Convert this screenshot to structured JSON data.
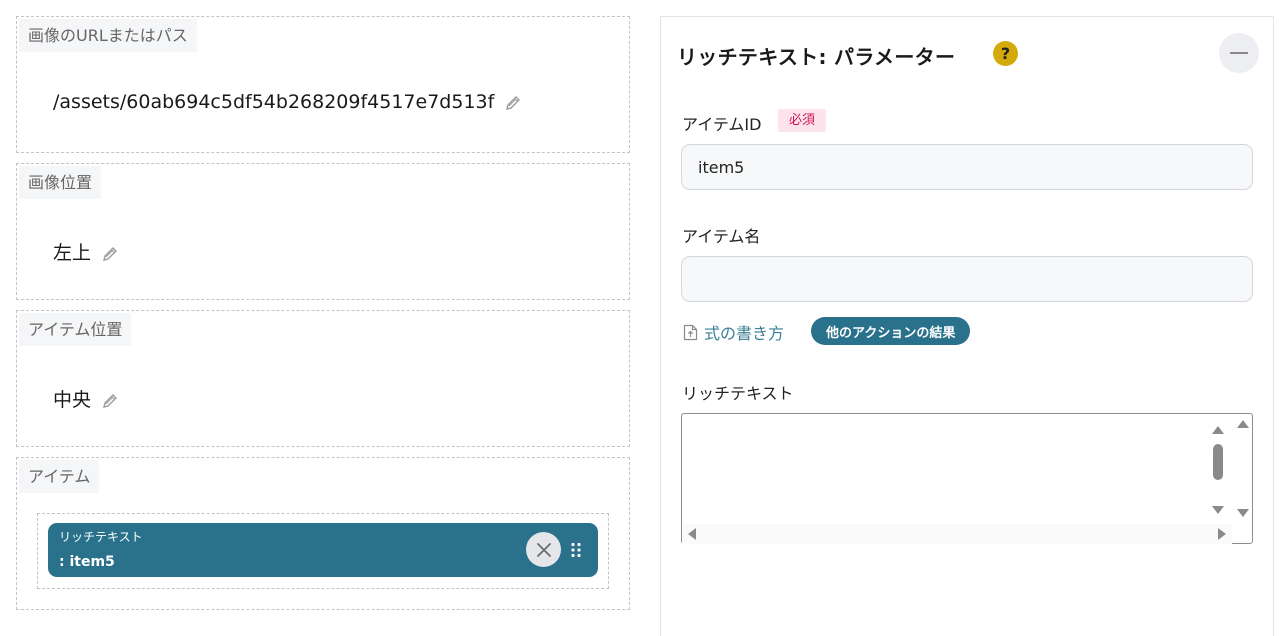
{
  "left": {
    "image_url": {
      "label": "画像のURLまたはパス",
      "value": "/assets/60ab694c5df54b268209f4517e7d513f"
    },
    "image_position": {
      "label": "画像位置",
      "value": "左上"
    },
    "item_position": {
      "label": "アイテム位置",
      "value": "中央"
    },
    "items": {
      "label": "アイテム",
      "chip": {
        "type": "リッチテキスト",
        "name": ": item5"
      }
    }
  },
  "panel": {
    "title": "リッチテキスト: パラメーター",
    "help": "?",
    "item_id": {
      "label": "アイテムID",
      "required": "必須",
      "value": "item5"
    },
    "item_name": {
      "label": "アイテム名",
      "value": ""
    },
    "formula_link": "式の書き方",
    "action_result_pill": "他のアクションの結果",
    "rich_text": {
      "label": "リッチテキスト",
      "value": ""
    }
  },
  "colors": {
    "accent": "#2a718b",
    "help": "#d4aa0b",
    "required_bg": "#fde4ec",
    "required_text": "#d4145a",
    "link": "#3d7f95"
  },
  "icons": [
    "pencil-icon",
    "close-icon",
    "drag-handle-icon",
    "help-icon",
    "minus-icon",
    "document-icon"
  ]
}
